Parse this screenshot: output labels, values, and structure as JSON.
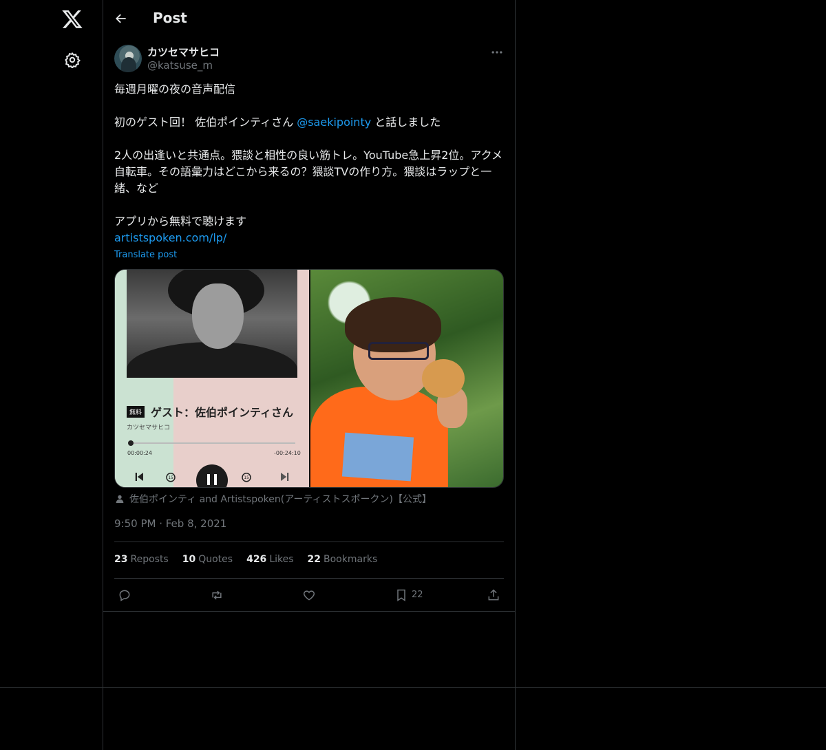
{
  "header": {
    "title": "Post"
  },
  "author": {
    "name": "カツセマサヒコ",
    "handle": "@katsuse_m"
  },
  "post": {
    "line1": "毎週月曜の夜の音声配信",
    "line2_pre": "初のゲスト回！ 佐伯ポインティさん ",
    "mention": "@saekipointy",
    "line2_post": " と話しました",
    "line3": "2人の出逢いと共通点。猥談と相性の良い筋トレ。YouTube急上昇2位。アクメ自転車。その語彙力はどこから来るの？猥談TVの作り方。猥談はラップと一緒、など",
    "line4": "アプリから無料で聴けます",
    "url": "artistspoken.com/lp/",
    "translate": "Translate post"
  },
  "media": {
    "badge": "無料",
    "guest_title": "ゲスト：佐伯ポインティさん",
    "artist": "カツセマサヒコ",
    "time_start": "00:00:24",
    "time_end": "-00:24:10"
  },
  "credit": "佐伯ポインティ and Artistspoken(アーティストスポークン)【公式】",
  "datetime": "9:50 PM · Feb 8, 2021",
  "stats": {
    "reposts_n": "23",
    "reposts_label": "Reposts",
    "quotes_n": "10",
    "quotes_label": "Quotes",
    "likes_n": "426",
    "likes_label": "Likes",
    "bookmarks_n": "22",
    "bookmarks_label": "Bookmarks"
  },
  "actions": {
    "bookmark_count": "22"
  },
  "icons": [
    "x-logo-icon",
    "gear-icon",
    "back-arrow-icon",
    "more-icon",
    "person-icon",
    "reply-icon",
    "repost-icon",
    "like-icon",
    "bookmark-icon",
    "share-icon"
  ]
}
